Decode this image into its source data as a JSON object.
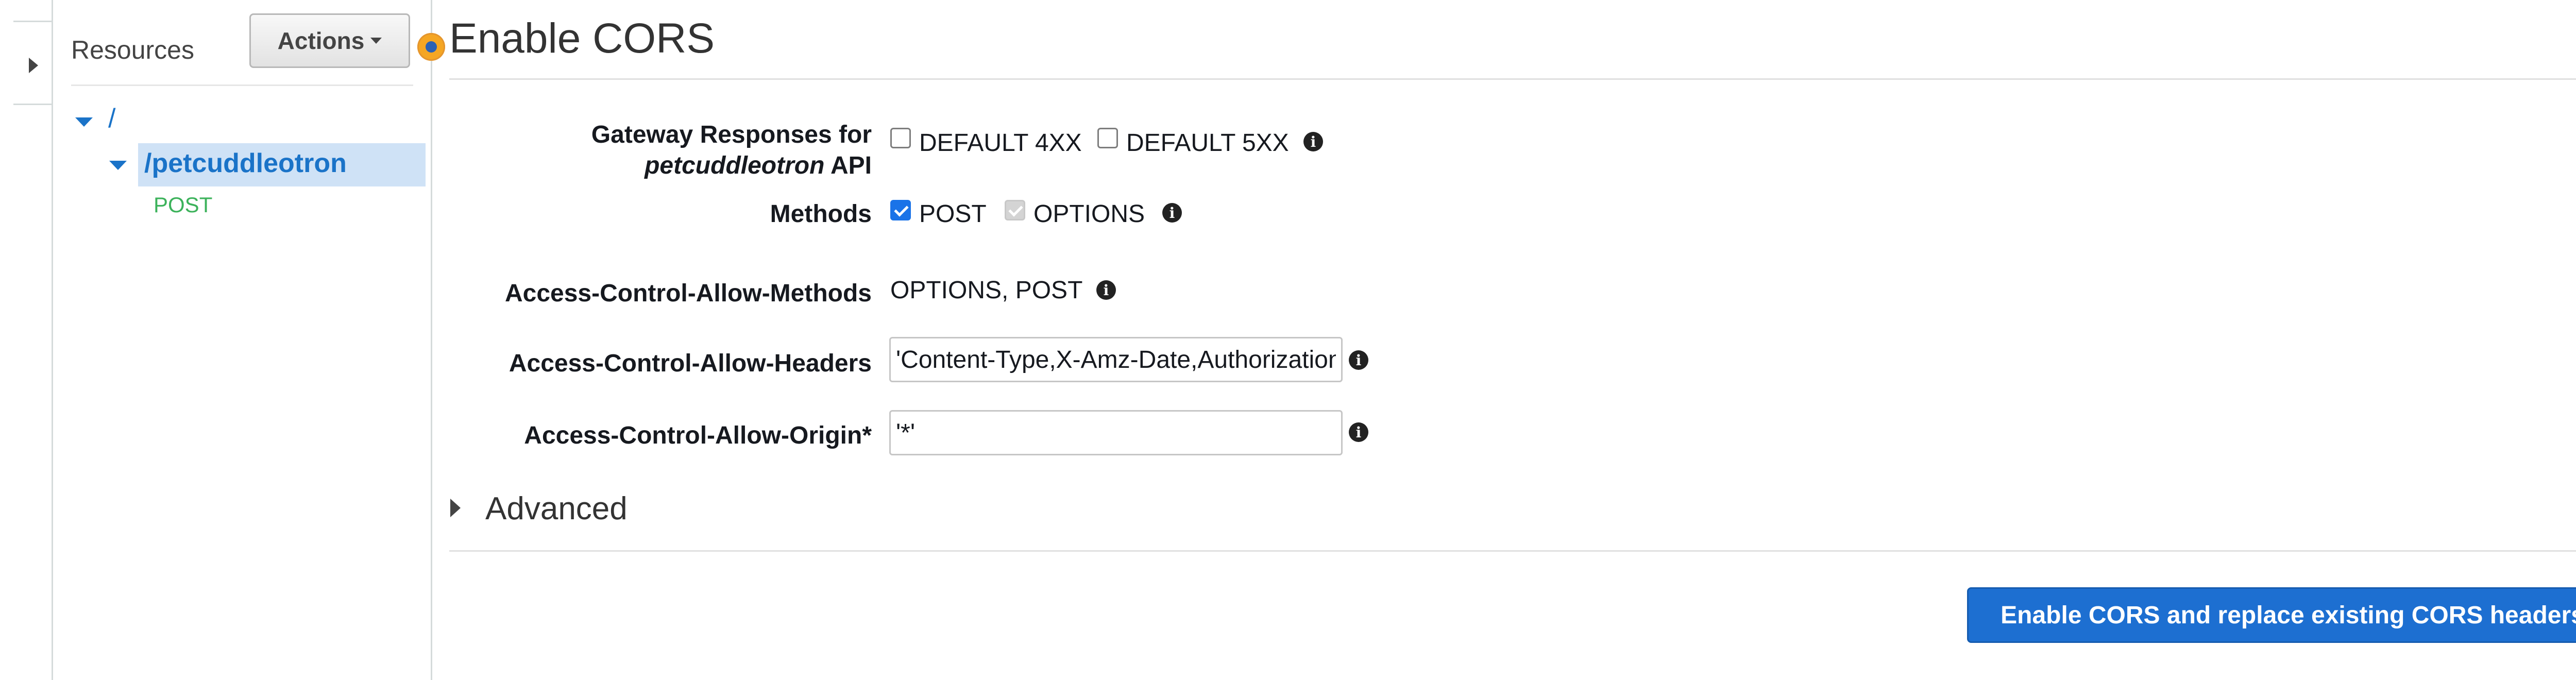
{
  "sidebar": {
    "resources_title": "Resources",
    "actions_label": "Actions",
    "tree": {
      "root_label": "/",
      "resource_label": "/petcuddleotron",
      "method_label": "POST"
    }
  },
  "main": {
    "title": "Enable CORS",
    "gateway_responses": {
      "label_line1": "Gateway Responses for",
      "label_api_name": "petcuddleotron",
      "label_api_suffix": " API",
      "options": [
        {
          "label": "DEFAULT 4XX",
          "checked": false
        },
        {
          "label": "DEFAULT 5XX",
          "checked": false
        }
      ]
    },
    "methods": {
      "label": "Methods",
      "options": [
        {
          "label": "POST",
          "checked": true,
          "disabled": false
        },
        {
          "label": "OPTIONS",
          "checked": true,
          "disabled": true
        }
      ]
    },
    "allow_methods": {
      "label": "Access-Control-Allow-Methods",
      "value": "OPTIONS, POST"
    },
    "allow_headers": {
      "label": "Access-Control-Allow-Headers",
      "value": "'Content-Type,X-Amz-Date,Authorization,X-Api-Key,X-Amz-Security-Token'"
    },
    "allow_origin": {
      "label": "Access-Control-Allow-Origin*",
      "value": "'*'"
    },
    "advanced_label": "Advanced",
    "submit_label": "Enable CORS and replace existing CORS headers"
  },
  "icons": {
    "info": "info-icon",
    "collapse": "chevron-right-icon",
    "dropdown": "caret-down-icon",
    "tree_expand": "caret-down-icon"
  },
  "colors": {
    "link_blue": "#1a73c8",
    "selected_bg": "#cfe2f6",
    "method_green": "#3cb25b",
    "primary_button": "#1d6fd1",
    "focus_marker": "#f5a623"
  }
}
